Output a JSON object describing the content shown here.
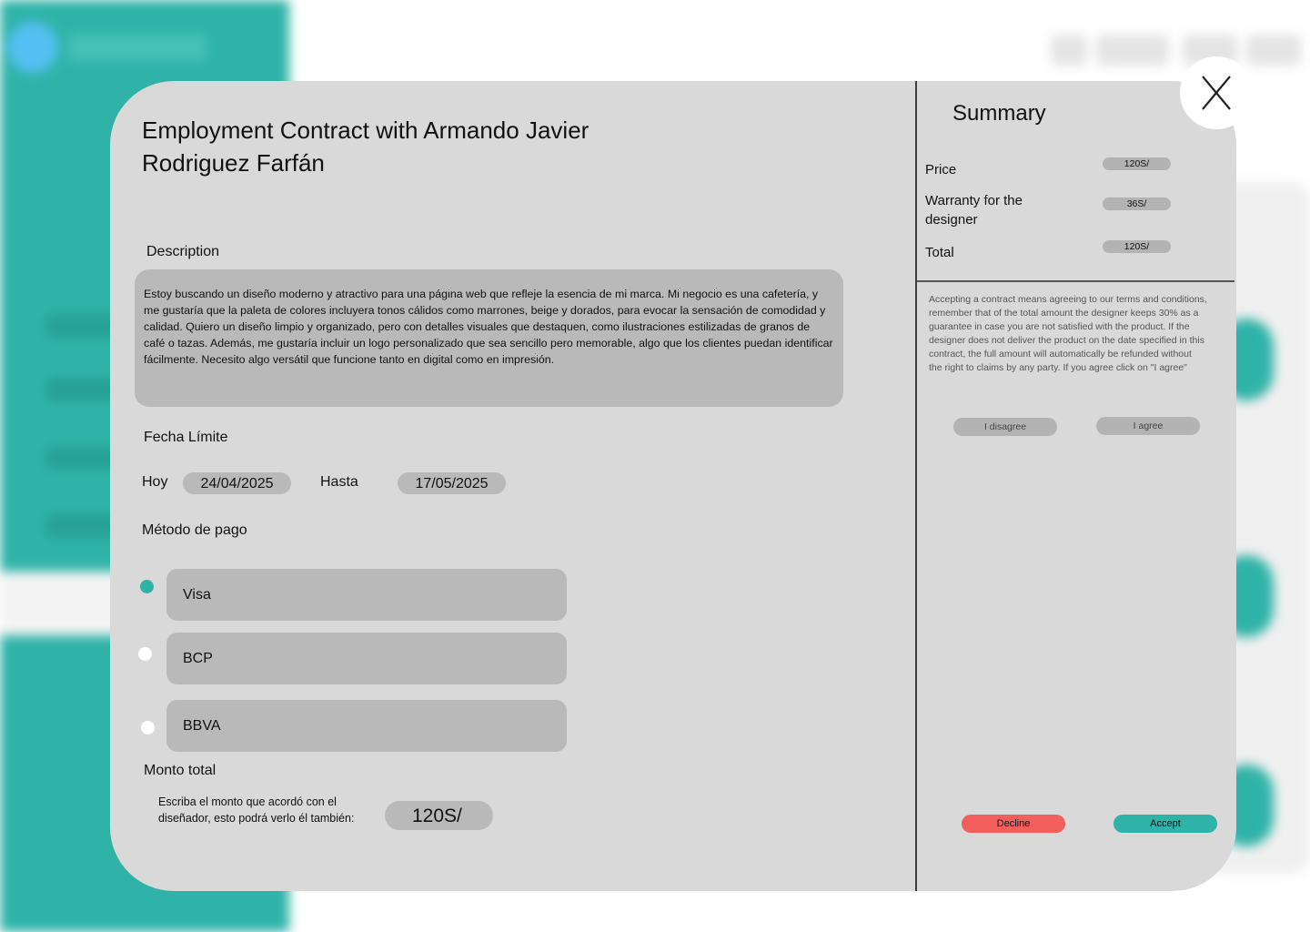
{
  "contract": {
    "title": "Employment Contract with Armando Javier Rodriguez Farfán",
    "description_label": "Description",
    "description": "Estoy buscando un diseño moderno y atractivo para una página web que refleje la esencia de mi marca. Mi negocio es una cafetería, y me gustaría que la paleta de colores incluyera tonos cálidos como marrones, beige y dorados, para evocar la sensación de comodidad y calidad. Quiero un diseño limpio y organizado, pero con detalles visuales que destaquen, como ilustraciones estilizadas de granos de café o tazas. Además, me gustaría incluir un logo personalizado que sea sencillo pero memorable, algo que los clientes puedan identificar fácilmente. Necesito algo versátil que funcione tanto en digital como en impresión.",
    "deadline_label": "Fecha Límite",
    "today_label": "Hoy",
    "today_value": "24/04/2025",
    "until_label": "Hasta",
    "until_value": "17/05/2025",
    "payment_label": "Método de pago",
    "payment_methods": [
      {
        "label": "Visa",
        "selected": true
      },
      {
        "label": "BCP",
        "selected": false
      },
      {
        "label": "BBVA",
        "selected": false
      }
    ],
    "total_label": "Monto total",
    "total_hint": "Escriba el monto que acordó con el diseñador, esto podrá verlo él también:",
    "total_value": "120S/"
  },
  "summary": {
    "title": "Summary",
    "price_label": "Price",
    "price_value": "120S/",
    "warranty_label": "Warranty for the designer",
    "warranty_value": "36S/",
    "total_label": "Total",
    "total_value": "120S/",
    "terms": "Accepting a contract means agreeing to our terms and conditions, remember that of the total amount the designer keeps 30% as a guarantee in case you are not satisfied with the product. If the designer does not deliver the product on the date specified in this contract, the full amount will automatically be refunded without the right to claims by any party. If you agree click on \"I agree\"",
    "disagree_label": "I disagree",
    "agree_label": "I agree",
    "decline_label": "Decline",
    "accept_label": "Accept"
  },
  "colors": {
    "accent": "#2fb3a8",
    "decline": "#f25f5c",
    "modal_bg": "#d9d9d9",
    "field_bg": "#b9b9b9"
  },
  "icons": {
    "close": "close-icon"
  }
}
